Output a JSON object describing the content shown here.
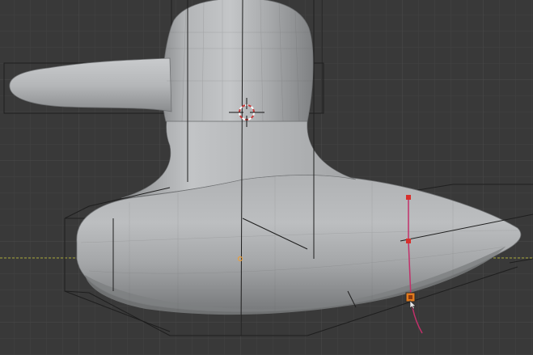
{
  "app": "3D viewport",
  "view": {
    "background": "#393939",
    "grid_minor": "#424242",
    "grid_major": "#4a4a4a",
    "axis_x_color": "#bfbf3a"
  },
  "mesh": {
    "name": "duck-sculpt",
    "base_color": "#a7a9ab",
    "shadow_color": "#6a6c6e",
    "highlight_color": "#cfd1d3"
  },
  "cage": {
    "line_color": "#1e1e1e"
  },
  "cursor_3d": {
    "icon": "crosshair-target-icon",
    "ring_color": "#c83a3a",
    "cross_color": "#141414"
  },
  "curve": {
    "line_color": "#c2306a",
    "point_color": "#d8302c",
    "active_handle_color": "#e07a1e"
  },
  "origin": {
    "icon": "object-origin-dot-icon",
    "color": "#e8a040"
  }
}
